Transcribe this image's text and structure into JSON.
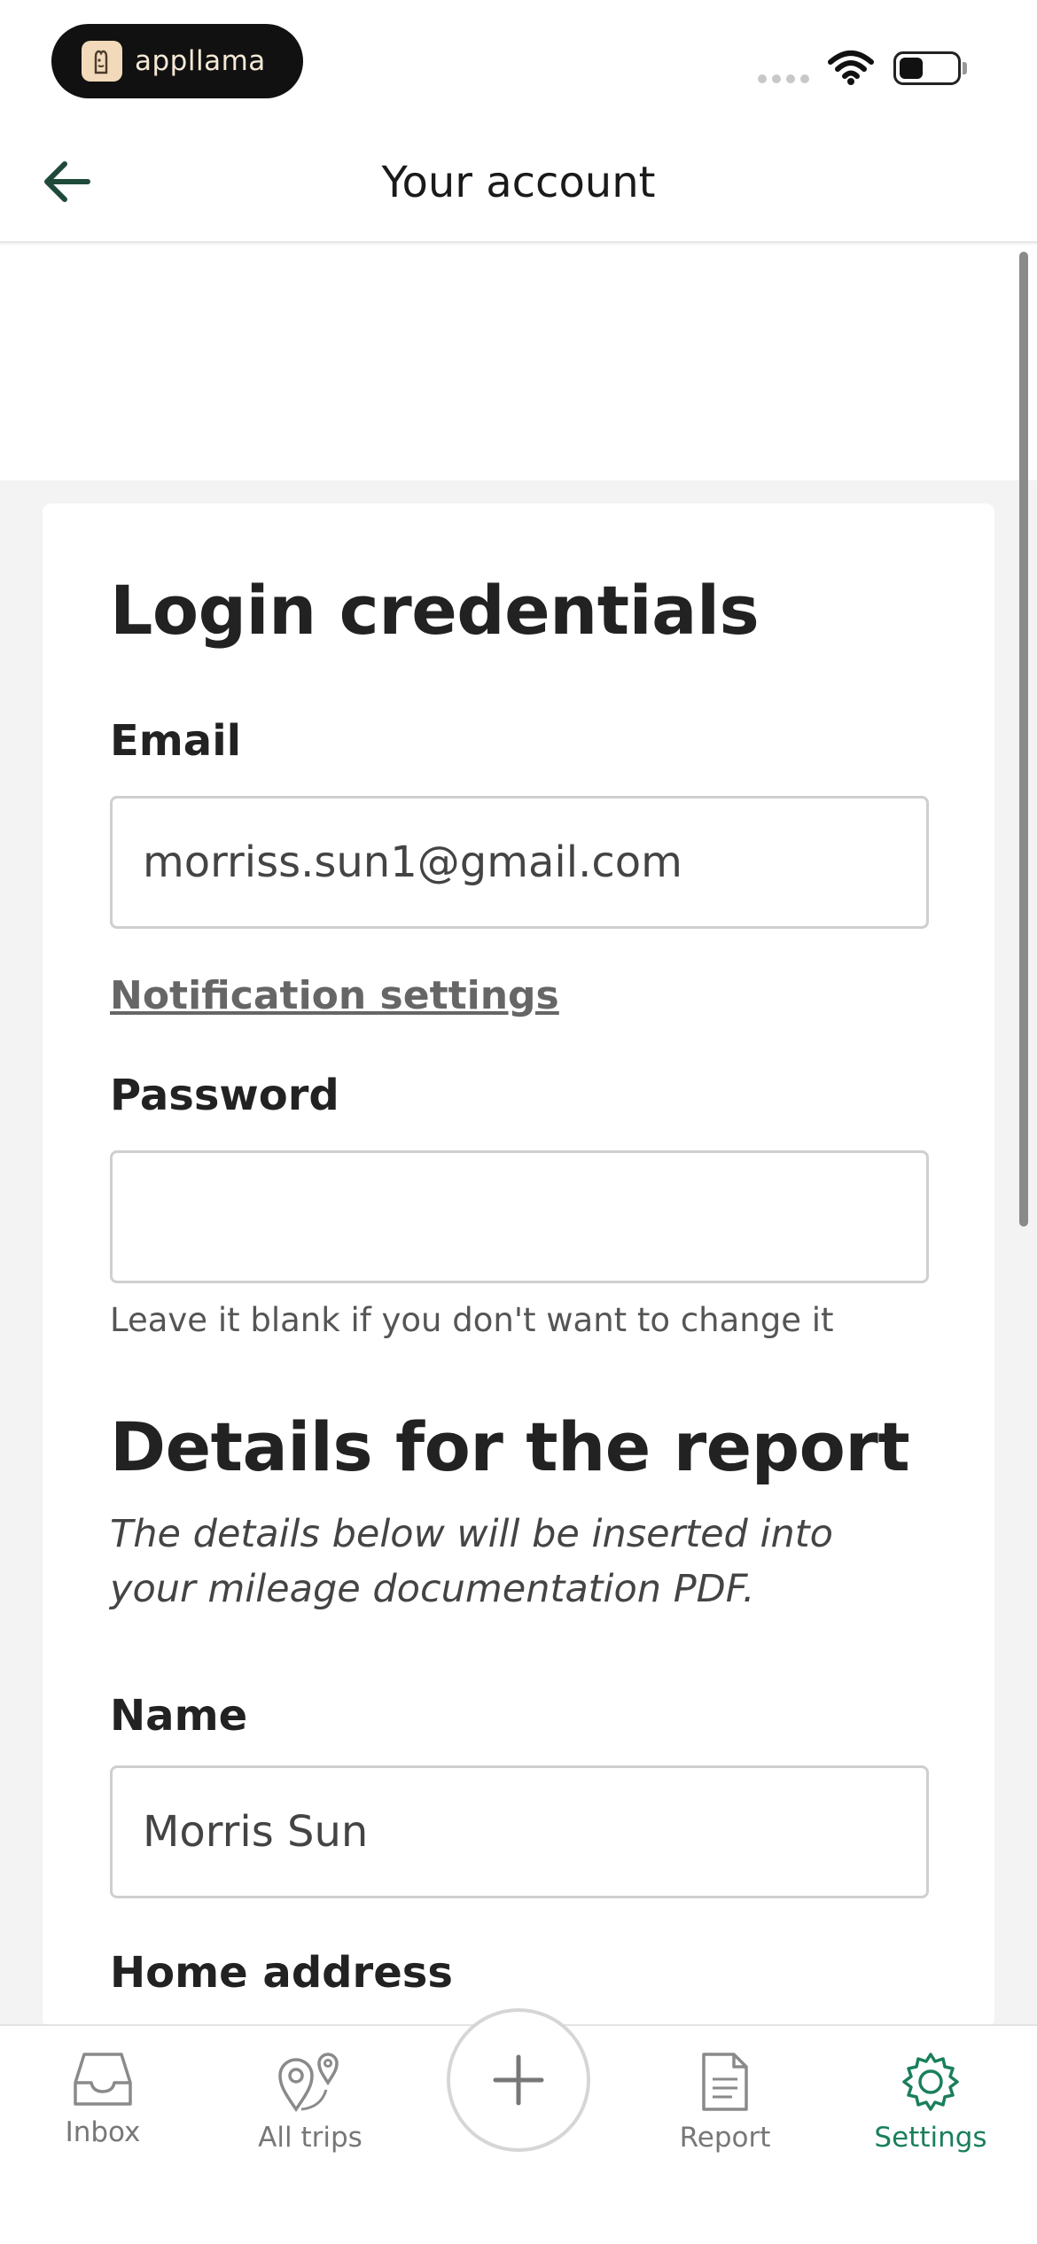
{
  "status_bar": {
    "app_badge": "appllama"
  },
  "header": {
    "title": "Your account"
  },
  "login": {
    "heading": "Login credentials",
    "email_label": "Email",
    "email_value": "morriss.sun1@gmail.com",
    "notification_link": "Notification settings",
    "password_label": "Password",
    "password_value": "",
    "password_hint": "Leave it blank if you don't want to change it"
  },
  "report": {
    "heading": "Details for the report",
    "description": "The details below will be inserted into your mileage documentation PDF.",
    "name_label": "Name",
    "name_value": "Morris Sun",
    "home_address_label": "Home address"
  },
  "tabbar": {
    "items": [
      {
        "label": "Inbox",
        "icon": "inbox-icon"
      },
      {
        "label": "All trips",
        "icon": "map-pins-icon"
      },
      {
        "label": "",
        "icon": "plus-icon"
      },
      {
        "label": "Report",
        "icon": "document-icon"
      },
      {
        "label": "Settings",
        "icon": "gear-icon"
      }
    ],
    "active": "Settings"
  },
  "colors": {
    "accent": "#1a7f5a",
    "back_arrow": "#1f4a3a",
    "background": "#f3f3f3"
  }
}
